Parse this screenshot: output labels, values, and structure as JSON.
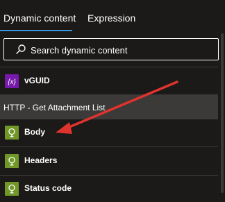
{
  "tabs": [
    {
      "label": "Dynamic content",
      "active": true
    },
    {
      "label": "Expression",
      "active": false
    }
  ],
  "search": {
    "placeholder": "Search dynamic content",
    "value": ""
  },
  "variables": {
    "icon_text": "{x}",
    "items": [
      {
        "label": "vGUID",
        "icon": "variable-icon"
      }
    ]
  },
  "section": {
    "title": "HTTP - Get Attachment List",
    "items": [
      {
        "label": "Body",
        "icon": "http-globe-icon"
      },
      {
        "label": "Headers",
        "icon": "http-globe-icon"
      },
      {
        "label": "Status code",
        "icon": "http-globe-icon"
      }
    ]
  },
  "colors": {
    "background": "#1b1a19",
    "accent": "#3a96dd",
    "variable_tile": "#7719aa",
    "http_tile": "#709727",
    "section_header": "#3b3a39",
    "annotation_arrow": "#e0332e"
  }
}
